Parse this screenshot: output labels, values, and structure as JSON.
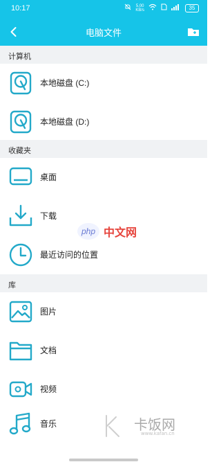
{
  "status_bar": {
    "time": "10:17",
    "net_speed_value": "5.00",
    "net_speed_unit": "KB/s",
    "battery": "35"
  },
  "app_bar": {
    "title": "电脑文件"
  },
  "sections": {
    "computer": {
      "header": "计算机",
      "items": [
        {
          "label": "本地磁盘 (C:)",
          "icon": "hard-disk-icon"
        },
        {
          "label": "本地磁盘 (D:)",
          "icon": "hard-disk-icon"
        }
      ]
    },
    "favorites": {
      "header": "收藏夹",
      "items": [
        {
          "label": "桌面",
          "icon": "desktop-monitor-icon"
        },
        {
          "label": "下载",
          "icon": "download-icon"
        },
        {
          "label": "最近访问的位置",
          "icon": "clock-icon"
        }
      ]
    },
    "library": {
      "header": "库",
      "items": [
        {
          "label": "图片",
          "icon": "image-icon"
        },
        {
          "label": "文档",
          "icon": "folder-icon"
        },
        {
          "label": "视频",
          "icon": "video-camera-icon"
        },
        {
          "label": "音乐",
          "icon": "music-note-icon"
        }
      ]
    }
  },
  "watermarks": {
    "php_logo": "php",
    "php_text": "中文网",
    "kafan_text": "卡饭网",
    "kafan_url": "www.kafan.cn"
  },
  "colors": {
    "accent": "#16c4e8",
    "icon": "#23a9c9",
    "section_bg": "#f0f2f4"
  }
}
